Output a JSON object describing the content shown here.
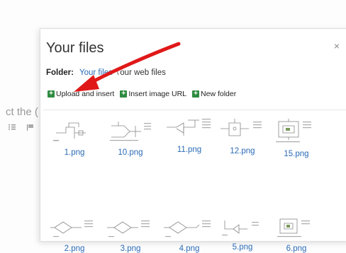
{
  "background": {
    "text": "ct the ("
  },
  "dialog": {
    "title": "Your files",
    "close_symbol": "×",
    "folder_label": "Folder:",
    "breadcrumb": {
      "root": "Your files",
      "separator": "\\",
      "current": "our web files"
    }
  },
  "actions": [
    {
      "label": "Upload and insert",
      "icon": "plus-icon"
    },
    {
      "label": "Insert image URL",
      "icon": "plus-icon"
    },
    {
      "label": "New folder",
      "icon": "plus-icon"
    }
  ],
  "files": [
    {
      "name": "1.png"
    },
    {
      "name": "10.png"
    },
    {
      "name": "11.png"
    },
    {
      "name": "12.png"
    },
    {
      "name": "15.png"
    },
    {
      "name": "2.png"
    },
    {
      "name": "3.png"
    },
    {
      "name": "4.png"
    },
    {
      "name": "5.png"
    },
    {
      "name": "6.png"
    }
  ],
  "colors": {
    "link": "#2a6bb6",
    "action_icon": "#2e8b40",
    "annotation_arrow": "#e01818"
  }
}
